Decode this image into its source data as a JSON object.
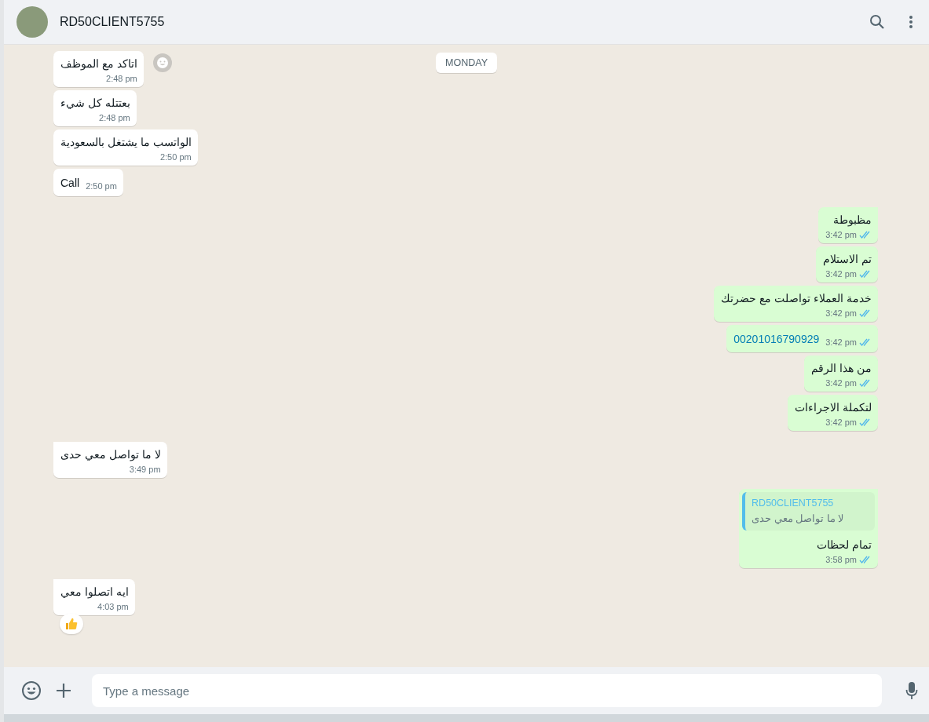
{
  "header": {
    "contact_name": "RD50CLIENT5755"
  },
  "date_chip": "MONDAY",
  "messages": [
    {
      "outgoing": false,
      "kind": "text",
      "tail": false,
      "text": "اتاكد مع الموظف",
      "time": "2:48 pm",
      "reaction_button": true
    },
    {
      "outgoing": false,
      "kind": "text",
      "tail": false,
      "text": "بعتتله كل شيء",
      "time": "2:48 pm"
    },
    {
      "outgoing": false,
      "kind": "text",
      "tail": false,
      "text": "الواتسب ما يشتغل بالسعودية",
      "time": "2:50 pm"
    },
    {
      "outgoing": false,
      "kind": "call",
      "tail": false,
      "text": "Call",
      "time": "2:50 pm"
    },
    {
      "outgoing": true,
      "kind": "text",
      "tail": true,
      "text": "مظبوطة",
      "time": "3:42 pm"
    },
    {
      "outgoing": true,
      "kind": "text",
      "tail": false,
      "text": "تم الاستلام",
      "time": "3:42 pm"
    },
    {
      "outgoing": true,
      "kind": "text",
      "tail": false,
      "text": "خدمة العملاء تواصلت مع حضرتك",
      "time": "3:42 pm"
    },
    {
      "outgoing": true,
      "kind": "phone",
      "tail": false,
      "text": "00201016790929",
      "time": "3:42 pm"
    },
    {
      "outgoing": true,
      "kind": "text",
      "tail": false,
      "text": "من هذا الرقم",
      "time": "3:42 pm"
    },
    {
      "outgoing": true,
      "kind": "text",
      "tail": false,
      "text": "لتكملة الاجراءات",
      "time": "3:42 pm"
    },
    {
      "outgoing": false,
      "kind": "text",
      "tail": true,
      "text": "لا ما تواصل معي حدى",
      "time": "3:49 pm"
    },
    {
      "outgoing": true,
      "kind": "reply",
      "tail": true,
      "quote": {
        "author": "RD50CLIENT5755",
        "text": "لا ما تواصل معي حدى"
      },
      "text": "تمام لحظات",
      "time": "3:58 pm"
    },
    {
      "outgoing": false,
      "kind": "text",
      "tail": true,
      "text": "ايه اتصلوا معي",
      "time": "4:03 pm",
      "reacted": true
    }
  ],
  "composer": {
    "placeholder": "Type a message"
  }
}
